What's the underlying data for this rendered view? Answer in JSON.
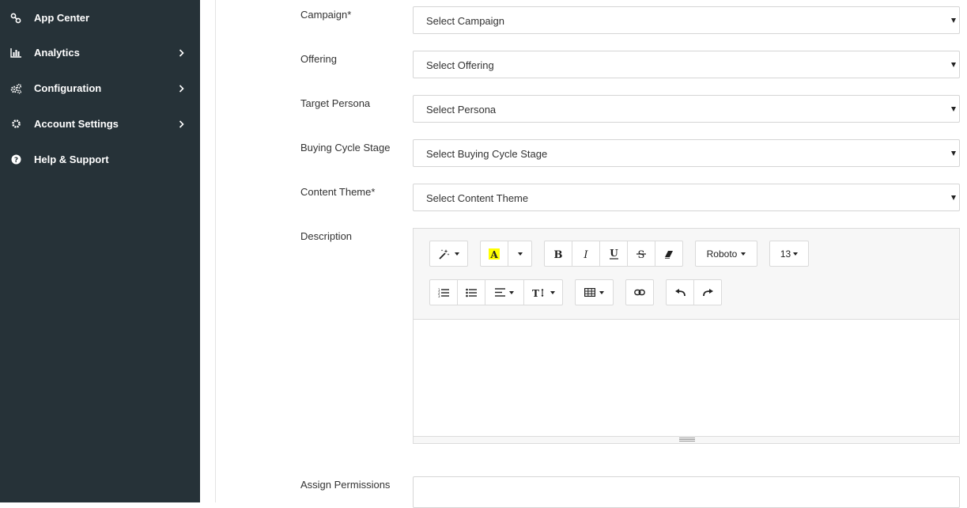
{
  "sidebar": {
    "items": [
      {
        "label": "App Center",
        "icon": "link-icon",
        "has_chevron": false
      },
      {
        "label": "Analytics",
        "icon": "bar-chart-icon",
        "has_chevron": true
      },
      {
        "label": "Configuration",
        "icon": "cogs-icon",
        "has_chevron": true
      },
      {
        "label": "Account Settings",
        "icon": "gear-icon",
        "has_chevron": true
      },
      {
        "label": "Help & Support",
        "icon": "question-circle-icon",
        "has_chevron": false
      }
    ]
  },
  "form": {
    "campaign": {
      "label": "Campaign*",
      "value": "Select Campaign"
    },
    "offering": {
      "label": "Offering",
      "value": "Select Offering"
    },
    "persona": {
      "label": "Target Persona",
      "value": "Select Persona"
    },
    "buying_stage": {
      "label": "Buying Cycle Stage",
      "value": "Select Buying Cycle Stage"
    },
    "content_theme": {
      "label": "Content Theme*",
      "value": "Select Content Theme"
    },
    "description": {
      "label": "Description"
    },
    "permissions": {
      "label": "Assign Permissions"
    }
  },
  "editor": {
    "font_name": "Roboto",
    "font_size": "13"
  },
  "colors": {
    "sidebar_bg": "#263238",
    "highlight_yellow": "#ffff00"
  }
}
